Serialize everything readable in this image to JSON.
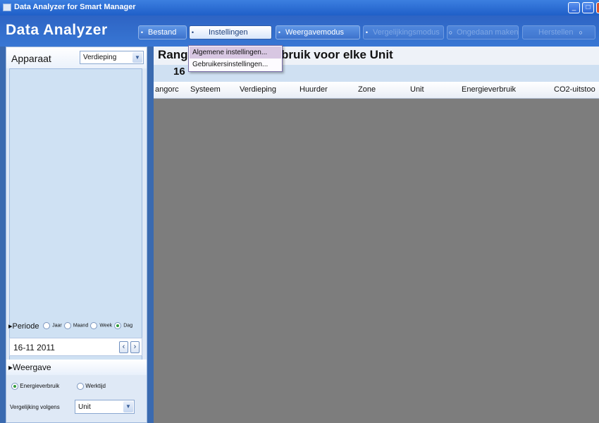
{
  "window": {
    "title": "Data Analyzer for Smart Manager",
    "controls": {
      "minimize": "_",
      "maximize": "□",
      "close": "×"
    }
  },
  "toolbar": {
    "brand": "Data Analyzer",
    "buttons": [
      {
        "label": "Bestand",
        "state": "normal"
      },
      {
        "label": "Instellingen",
        "state": "active"
      },
      {
        "label": "Weergavemodus",
        "state": "normal"
      },
      {
        "label": "Vergelijkingsmodus",
        "state": "disabled"
      },
      {
        "label": "Ongedaan maken",
        "state": "disabled"
      },
      {
        "label": "Herstellen",
        "state": "disabled"
      }
    ]
  },
  "dropdown_menu": {
    "items": [
      {
        "label": "Algemene instellingen...",
        "highlighted": true
      },
      {
        "label": "Gebruikersinstellingen...",
        "highlighted": false
      }
    ]
  },
  "sidebar": {
    "apparaat_label": "Apparaat",
    "apparaat_select": "Verdieping",
    "periode": {
      "label": "Periode",
      "options": [
        {
          "label": "Jaar",
          "selected": false
        },
        {
          "label": "Maand",
          "selected": false
        },
        {
          "label": "Week",
          "selected": false
        },
        {
          "label": "Dag",
          "selected": true
        }
      ]
    },
    "date": "16-11 2011",
    "weergave": {
      "label": "Weergave",
      "options": [
        {
          "label": "Energieverbruik",
          "selected": true
        },
        {
          "label": "Werktijd",
          "selected": false
        }
      ]
    },
    "vergelijking_label": "Vergelijking volgens",
    "vergelijking_select": "Unit"
  },
  "main": {
    "title_left": "Rang",
    "title_right": "bruik voor elke Unit",
    "date_visible": "16",
    "columns": [
      "angorc",
      "Systeem",
      "Verdieping",
      "Huurder",
      "Zone",
      "Unit",
      "Energieverbruik",
      "CO2-uitstoo"
    ]
  },
  "colors": {
    "accent_blue": "#3877d4",
    "menu_highlight": "#d8c7e2",
    "main_background": "#7d7d7d"
  }
}
